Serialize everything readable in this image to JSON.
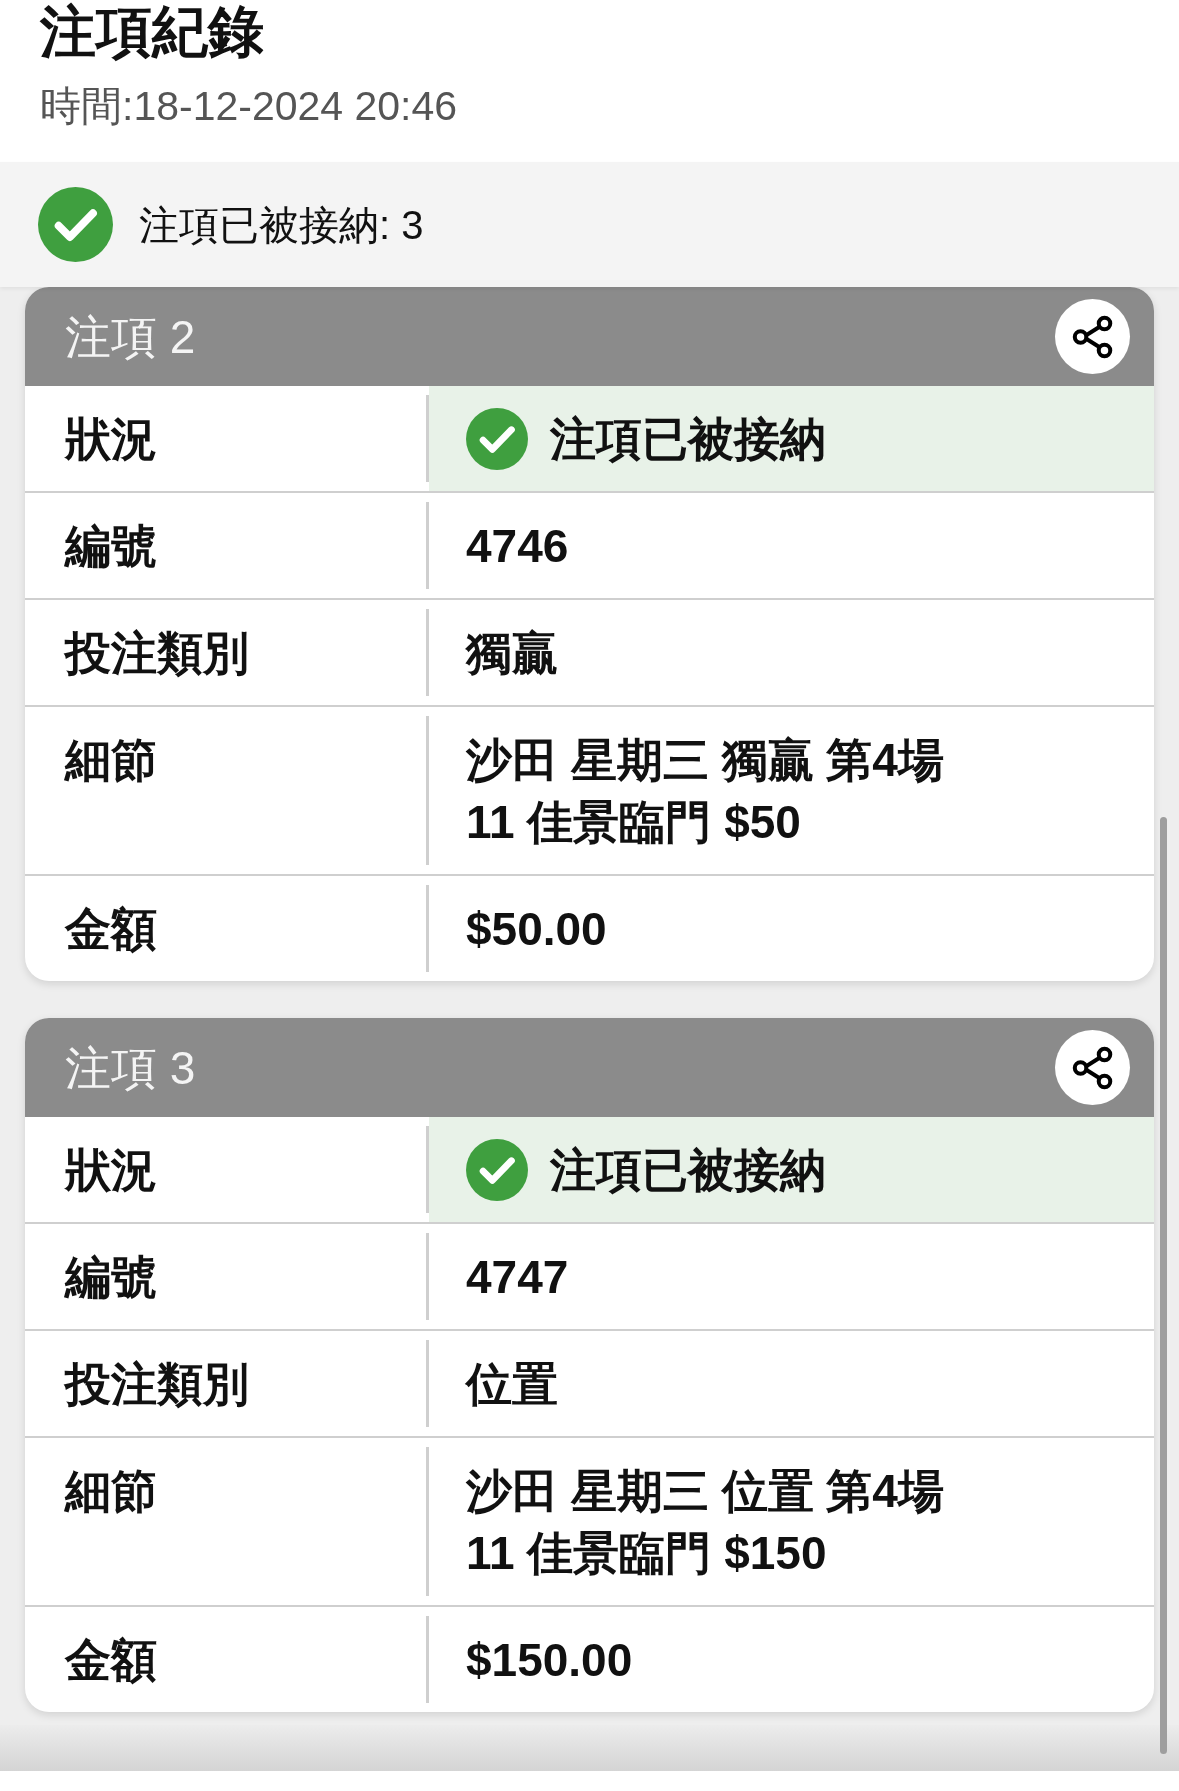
{
  "header": {
    "title": "注項紀錄",
    "time": "時間:18-12-2024 20:46"
  },
  "summary": {
    "accepted": true,
    "text": "注項已被接納: 3"
  },
  "bets": [
    {
      "title": "注項 2",
      "rows": [
        {
          "kind": "status",
          "label": "狀況",
          "accepted": true,
          "value": "注項已被接納"
        },
        {
          "kind": "text",
          "label": "編號",
          "value": "4746"
        },
        {
          "kind": "text",
          "label": "投注類別",
          "value": "獨贏"
        },
        {
          "kind": "text",
          "label": "細節",
          "value": "沙田 星期三 獨贏 第4場\n11 佳景臨門 $50"
        },
        {
          "kind": "text",
          "label": "金額",
          "value": "$50.00"
        }
      ]
    },
    {
      "title": "注項 3",
      "rows": [
        {
          "kind": "status",
          "label": "狀況",
          "accepted": true,
          "value": "注項已被接納"
        },
        {
          "kind": "text",
          "label": "編號",
          "value": "4747"
        },
        {
          "kind": "text",
          "label": "投注類別",
          "value": "位置"
        },
        {
          "kind": "text",
          "label": "細節",
          "value": "沙田 星期三 位置 第4場\n11 佳景臨門 $150"
        },
        {
          "kind": "text",
          "label": "金額",
          "value": "$150.00"
        }
      ]
    }
  ]
}
